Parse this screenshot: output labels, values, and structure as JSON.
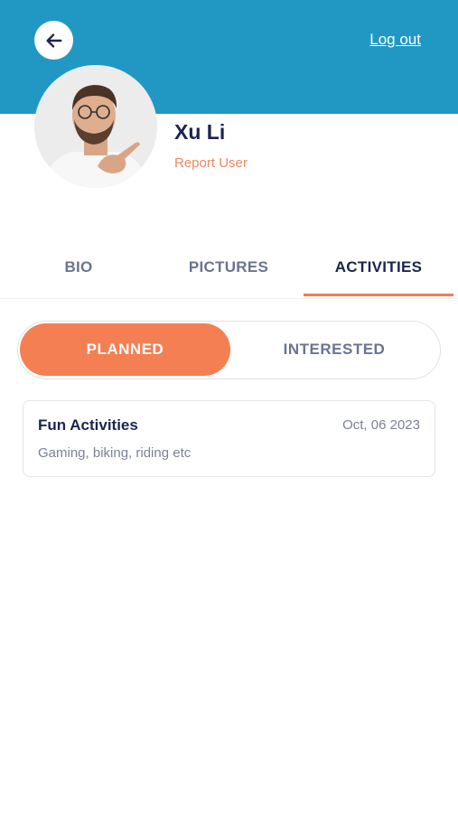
{
  "header": {
    "logout_label": "Log out",
    "accent_color": "#2198c4"
  },
  "profile": {
    "name": "Xu Li",
    "report_label": "Report User",
    "avatar_icon": "person-photo"
  },
  "tabs": [
    {
      "label": "BIO",
      "active": false
    },
    {
      "label": "PICTURES",
      "active": false
    },
    {
      "label": "ACTIVITIES",
      "active": true
    }
  ],
  "segment": {
    "planned_label": "PLANNED",
    "interested_label": "INTERESTED",
    "selected": "planned",
    "active_color": "#f47f52"
  },
  "activities": [
    {
      "title": "Fun Activities",
      "date": "Oct, 06 2023",
      "description": "Gaming, biking, riding etc"
    }
  ]
}
